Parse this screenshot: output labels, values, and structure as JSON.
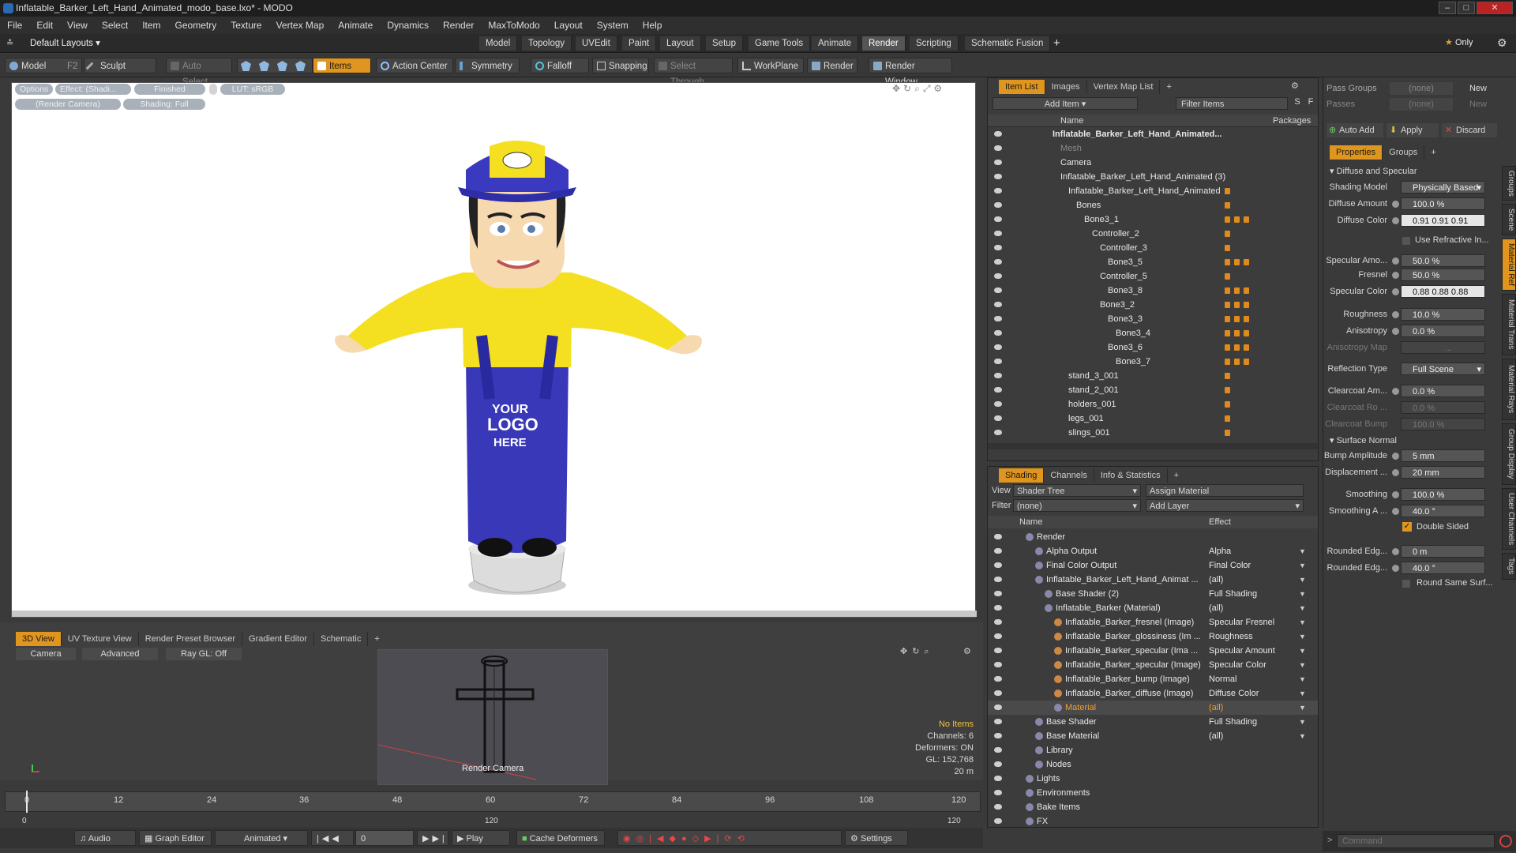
{
  "window": {
    "title": "Inflatable_Barker_Left_Hand_Animated_modo_base.lxo* - MODO"
  },
  "menu": [
    "File",
    "Edit",
    "View",
    "Select",
    "Item",
    "Geometry",
    "Texture",
    "Vertex Map",
    "Animate",
    "Dynamics",
    "Render",
    "MaxToModo",
    "Layout",
    "System",
    "Help"
  ],
  "layout": {
    "default_layouts": "Default Layouts",
    "tabs": [
      "Model",
      "Topology",
      "UVEdit",
      "Paint",
      "Layout",
      "Setup",
      "Game Tools",
      "Animate",
      "Render",
      "Scripting",
      "Schematic Fusion"
    ],
    "active_tab": "Render",
    "only_label": "Only",
    "plus": "+"
  },
  "toolbar": {
    "model": "Model",
    "f2": "F2",
    "sculpt": "Sculpt",
    "auto_select": "Auto Select",
    "items": "Items",
    "action_center": "Action Center",
    "symmetry": "Symmetry",
    "falloff": "Falloff",
    "snapping": "Snapping",
    "select_through": "Select Through",
    "workplane": "WorkPlane",
    "render": "Render",
    "render_window": "Render Window"
  },
  "viewport": {
    "options": "Options",
    "effect": "Effect: (Shadi...",
    "finished": "Finished",
    "lut": "LUT: sRGB",
    "render_camera": "(Render Camera)",
    "shading": "Shading: Full",
    "logo_line1": "YOUR",
    "logo_line2": "LOGO",
    "logo_line3": "HERE"
  },
  "bottom_view": {
    "tabs": [
      "3D View",
      "UV Texture View",
      "Render Preset Browser",
      "Gradient Editor",
      "Schematic"
    ],
    "camera": "Camera",
    "advanced": "Advanced",
    "raygl": "Ray GL: Off",
    "render_camera_label": "Render Camera",
    "stats": [
      "No Items",
      "Channels: 6",
      "Deformers: ON",
      "GL: 152,768",
      "20 m"
    ]
  },
  "timeline": {
    "ticks": [
      "0",
      "12",
      "24",
      "36",
      "48",
      "60",
      "72",
      "84",
      "96",
      "108",
      "120"
    ],
    "start": "0",
    "mid": "120",
    "end": "120"
  },
  "transport": {
    "audio": "Audio",
    "graph_editor": "Graph Editor",
    "animated": "Animated",
    "frame": "0",
    "play": "Play",
    "cache_deformers": "Cache Deformers",
    "settings": "Settings"
  },
  "item_list": {
    "tabs": [
      "Item List",
      "Images",
      "Vertex Map List"
    ],
    "add_item": "Add Item",
    "filter_items": "Filter Items",
    "s": "S",
    "f": "F",
    "col_name": "Name",
    "col_packages": "Packages",
    "rows": [
      {
        "label": "Inflatable_Barker_Left_Hand_Animated...",
        "indent": 0,
        "bold": true,
        "pkg": 0
      },
      {
        "label": "Mesh",
        "indent": 1,
        "dim": true,
        "pkg": 0
      },
      {
        "label": "Camera",
        "indent": 1,
        "pkg": 0
      },
      {
        "label": "Inflatable_Barker_Left_Hand_Animated (3)",
        "indent": 1,
        "pkg": 0
      },
      {
        "label": "Inflatable_Barker_Left_Hand_Animated",
        "indent": 2,
        "pkg": 1
      },
      {
        "label": "Bones",
        "indent": 3,
        "pkg": 1
      },
      {
        "label": "Bone3_1",
        "indent": 4,
        "pkg": 3
      },
      {
        "label": "Controller_2",
        "indent": 5,
        "pkg": 1
      },
      {
        "label": "Controller_3",
        "indent": 6,
        "pkg": 1
      },
      {
        "label": "Bone3_5",
        "indent": 7,
        "pkg": 3
      },
      {
        "label": "Controller_5",
        "indent": 6,
        "pkg": 1
      },
      {
        "label": "Bone3_8",
        "indent": 7,
        "pkg": 3
      },
      {
        "label": "Bone3_2",
        "indent": 6,
        "pkg": 3
      },
      {
        "label": "Bone3_3",
        "indent": 7,
        "pkg": 3
      },
      {
        "label": "Bone3_4",
        "indent": 8,
        "pkg": 3
      },
      {
        "label": "Bone3_6",
        "indent": 7,
        "pkg": 3
      },
      {
        "label": "Bone3_7",
        "indent": 8,
        "pkg": 3
      },
      {
        "label": "stand_3_001",
        "indent": 2,
        "pkg": 1
      },
      {
        "label": "stand_2_001",
        "indent": 2,
        "pkg": 1
      },
      {
        "label": "holders_001",
        "indent": 2,
        "pkg": 1
      },
      {
        "label": "legs_001",
        "indent": 2,
        "pkg": 1
      },
      {
        "label": "slings_001",
        "indent": 2,
        "pkg": 1
      }
    ]
  },
  "shading": {
    "tabs": [
      "Shading",
      "Channels",
      "Info & Statistics"
    ],
    "view_label": "View",
    "view_value": "Shader Tree",
    "assign_material": "Assign Material",
    "filter_label": "Filter",
    "filter_value": "(none)",
    "add_layer": "Add Layer",
    "col_name": "Name",
    "col_effect": "Effect",
    "rows": [
      {
        "label": "Render",
        "effect": "",
        "indent": 0
      },
      {
        "label": "Alpha Output",
        "effect": "Alpha",
        "indent": 1
      },
      {
        "label": "Final Color Output",
        "effect": "Final Color",
        "indent": 1
      },
      {
        "label": "Inflatable_Barker_Left_Hand_Animat ...",
        "effect": "(all)",
        "indent": 1
      },
      {
        "label": "Base Shader (2)",
        "effect": "Full Shading",
        "indent": 2
      },
      {
        "label": "Inflatable_Barker (Material)",
        "effect": "(all)",
        "indent": 2
      },
      {
        "label": "Inflatable_Barker_fresnel (Image)",
        "effect": "Specular Fresnel",
        "indent": 3
      },
      {
        "label": "Inflatable_Barker_glossiness (Im ...",
        "effect": "Roughness",
        "indent": 3
      },
      {
        "label": "Inflatable_Barker_specular (Ima ...",
        "effect": "Specular Amount",
        "indent": 3
      },
      {
        "label": "Inflatable_Barker_specular (Image)",
        "effect": "Specular Color",
        "indent": 3
      },
      {
        "label": "Inflatable_Barker_bump (Image)",
        "effect": "Normal",
        "indent": 3
      },
      {
        "label": "Inflatable_Barker_diffuse (Image)",
        "effect": "Diffuse Color",
        "indent": 3
      },
      {
        "label": "Material",
        "effect": "(all)",
        "indent": 3,
        "sel": true
      },
      {
        "label": "Base Shader",
        "effect": "Full Shading",
        "indent": 1
      },
      {
        "label": "Base Material",
        "effect": "(all)",
        "indent": 1
      },
      {
        "label": "Library",
        "effect": "",
        "indent": 1
      },
      {
        "label": "Nodes",
        "effect": "",
        "indent": 1
      },
      {
        "label": "Lights",
        "effect": "",
        "indent": 0
      },
      {
        "label": "Environments",
        "effect": "",
        "indent": 0
      },
      {
        "label": "Bake Items",
        "effect": "",
        "indent": 0
      },
      {
        "label": "FX",
        "effect": "",
        "indent": 0
      }
    ]
  },
  "properties": {
    "pass_groups": "Pass Groups",
    "pass_groups_value": "(none)",
    "new": "New",
    "passes": "Passes",
    "passes_value": "(none)",
    "auto_add": "Auto Add",
    "apply": "Apply",
    "discard": "Discard",
    "tabs": [
      "Properties",
      "Groups"
    ],
    "section_diffuse": "Diffuse and Specular",
    "shading_model_label": "Shading Model",
    "shading_model": "Physically Based",
    "diffuse_amount_label": "Diffuse Amount",
    "diffuse_amount": "100.0 %",
    "diffuse_color_label": "Diffuse Color",
    "diffuse_color": "0.91  0.91  0.91",
    "use_refractive": "Use Refractive In...",
    "specular_amount_label": "Specular Amo...",
    "specular_amount": "50.0 %",
    "fresnel_label": "Fresnel",
    "fresnel": "50.0 %",
    "specular_color_label": "Specular Color",
    "specular_color": "0.88  0.88  0.88",
    "roughness_label": "Roughness",
    "roughness": "10.0 %",
    "anisotropy_label": "Anisotropy",
    "anisotropy": "0.0 %",
    "anisotropy_map_label": "Anisotropy Map",
    "anisotropy_map": "...",
    "reflection_type_label": "Reflection Type",
    "reflection_type": "Full Scene",
    "clearcoat_am_label": "Clearcoat Am...",
    "clearcoat_am": "0.0 %",
    "clearcoat_ro_label": "Clearcoat Ro ...",
    "clearcoat_ro": "0.0 %",
    "clearcoat_bump_label": "Clearcoat Bump",
    "clearcoat_bump": "100.0 %",
    "section_surface": "Surface Normal",
    "bump_amplitude_label": "Bump Amplitude",
    "bump_amplitude": "5 mm",
    "displacement_label": "Displacement ...",
    "displacement": "20 mm",
    "smoothing_label": "Smoothing",
    "smoothing": "100.0 %",
    "smoothing_a_label": "Smoothing A ...",
    "smoothing_a": "40.0 °",
    "double_sided": "Double Sided",
    "rounded1_label": "Rounded Edg...",
    "rounded1": "0 m",
    "rounded2_label": "Rounded Edg...",
    "rounded2": "40.0 °",
    "round_same": "Round Same Surf...",
    "side_tabs": [
      "Groups",
      "Scene",
      "Material Ref",
      "Material Trans",
      "Material Rays",
      "Group Display",
      "User Channels",
      "Tags"
    ],
    "command_placeholder": "Command"
  }
}
